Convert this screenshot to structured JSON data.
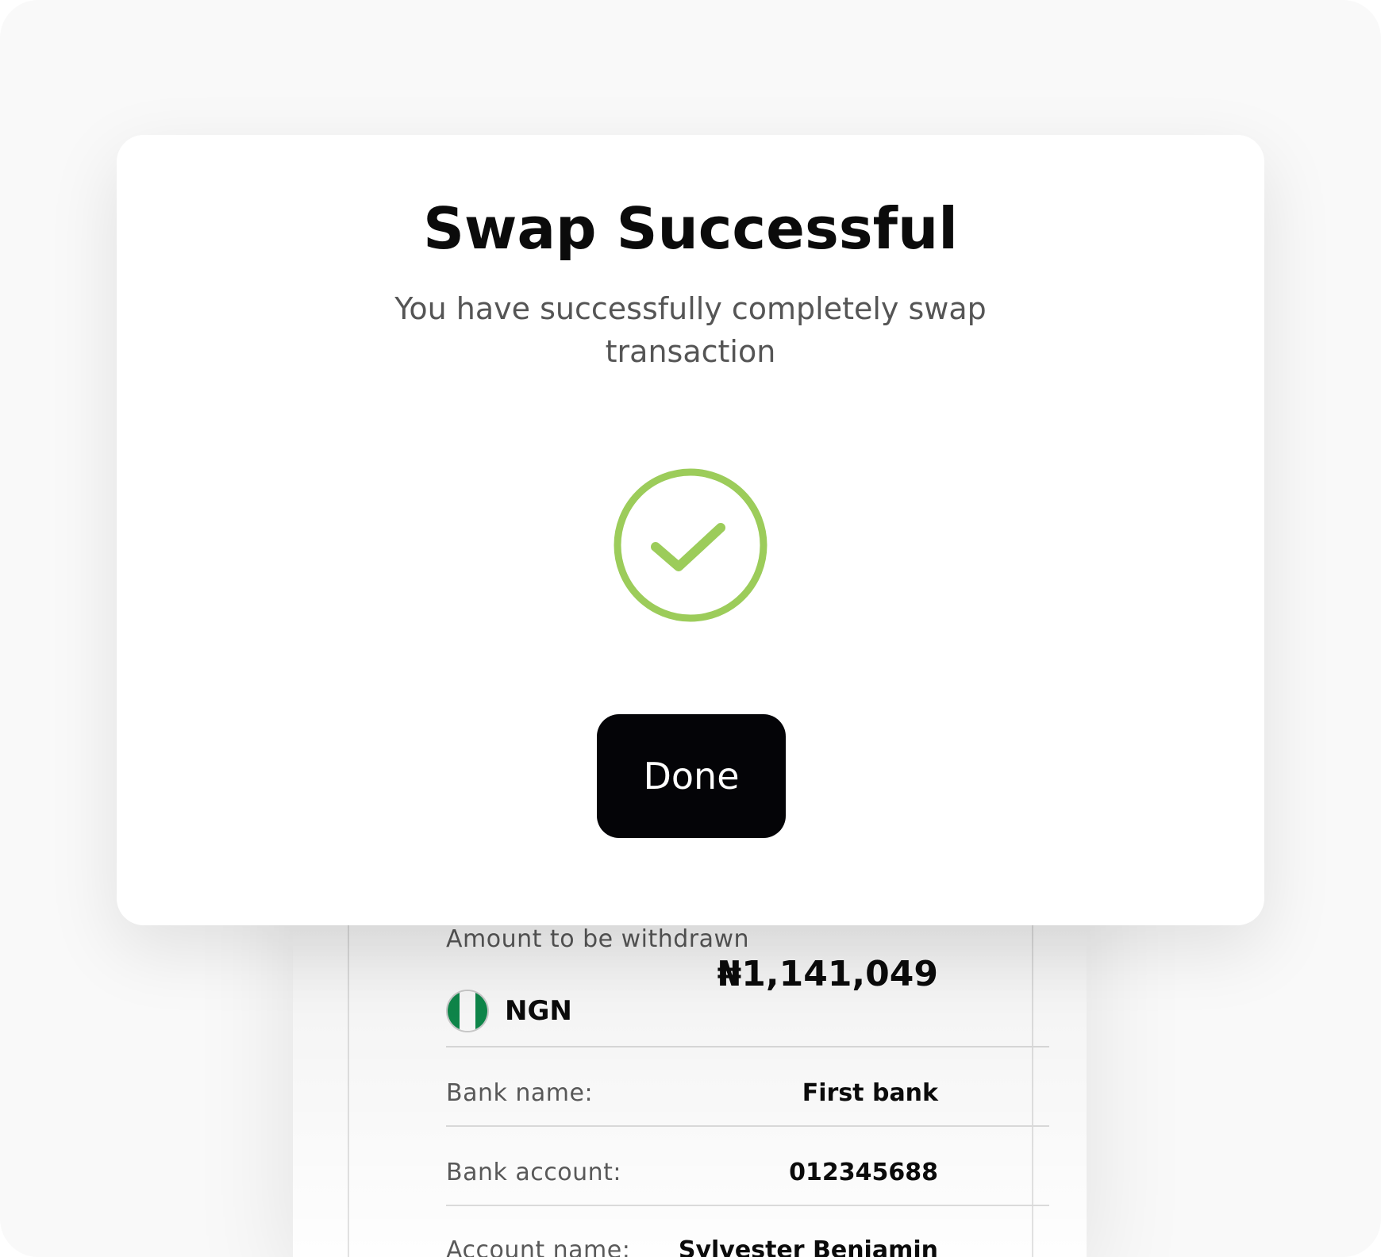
{
  "modal": {
    "title": "Swap Successful",
    "subtitle": "You have successfully completely swap transaction",
    "done_label": "Done",
    "check_color": "#9ccc5a"
  },
  "withdrawal": {
    "amount_label": "Amount to be withdrawn",
    "currency_code": "NGN",
    "amount": "₦1,141,049",
    "details": [
      {
        "label": "Bank name:",
        "value": "First bank"
      },
      {
        "label": "Bank account:",
        "value": "012345688"
      },
      {
        "label": "Account name:",
        "value": "Sylvester Benjamin"
      }
    ]
  },
  "colors": {
    "button_bg": "#040407",
    "flag_green": "#0f8a4c"
  }
}
